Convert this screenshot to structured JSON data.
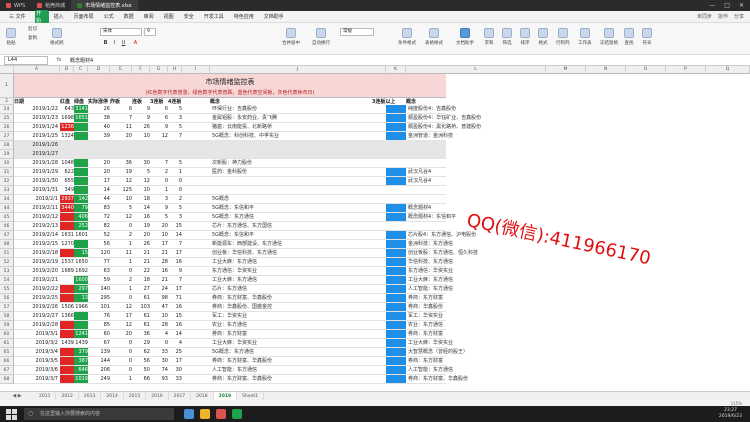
{
  "titlebar": {
    "tabs": [
      {
        "label": "WPS"
      },
      {
        "label": "稻壳商城"
      },
      {
        "label": "市场情绪监控表.xlsx"
      }
    ],
    "controls": [
      "—",
      "□",
      "✕"
    ]
  },
  "menubar": {
    "items": [
      "三 文件",
      "开始",
      "插入",
      "页面布局",
      "公式",
      "数据",
      "审阅",
      "视图",
      "安全",
      "开发工具",
      "特色应用",
      "文档助手"
    ],
    "right": [
      "未同步",
      "协作",
      "分享"
    ]
  },
  "ribbon": {
    "paste": "粘贴",
    "cut": "剪切",
    "copy": "复制",
    "format_painter": "格式刷",
    "font": "宋体",
    "size": "9",
    "merge": "合并居中",
    "wrap": "自动换行",
    "number_format": "常规",
    "conditional": "条件格式",
    "table_style": "表格样式",
    "doc_helper": "文档助手",
    "sum": "求和",
    "filter": "筛选",
    "sort": "排序",
    "format": "格式",
    "row_col": "行和列",
    "worksheet": "工作表",
    "freeze": "冻结窗格",
    "find": "查找",
    "symbol": "符号"
  },
  "formulabar": {
    "namebox": "L44",
    "fx": "fx",
    "content": "概念题材4"
  },
  "sheet": {
    "title": "市场情绪监控表",
    "subtitle": "(红色数字代表普涨，绿色数字代表普跌，蓝色代表空间板，灰色代表休市日)",
    "headers": {
      "date": "日期",
      "up": "红盘",
      "down": "绿盘",
      "limit_up": "实际涨停",
      "fail": "炸板",
      "l2": "连板",
      "l3": "3连板",
      "l4": "4连板",
      "concept": "概念",
      "above": "3连板以上",
      "concept2": "概念"
    },
    "rows": [
      {
        "r": "24",
        "date": "2019/1/22",
        "v": [
          "643",
          "3141",
          "26",
          "6",
          "9",
          "6",
          "5"
        ],
        "t1": "环保行业：吉鑫股份",
        "t2": "纯度股份4：吉鑫股份",
        "hl": "n2g"
      },
      {
        "r": "25",
        "date": "2019/1/23",
        "v": [
          "1698",
          "1651",
          "38",
          "7",
          "9",
          "6",
          "3"
        ],
        "t1": "金属铝股：永安药业、贵飞腾",
        "t2": "顺盈股份4：华钰矿业、吉鑫股份",
        "hl": "n2g"
      },
      {
        "r": "26",
        "date": "2019/1/24",
        "v": [
          "1236",
          "",
          "40",
          "11",
          "26",
          "9",
          "5"
        ],
        "t1": "猪瘟：云南能投、北新路桥",
        "t2": "顺盈股份4：黑化路桥、普建股份",
        "hl": "n1r"
      },
      {
        "r": "27",
        "date": "2019/1/25",
        "v": [
          "1324",
          "",
          "39",
          "20",
          "10",
          "12",
          "7"
        ],
        "t1": "5G概念：科创科技、中孚实业",
        "t2": "金洲管道：金洲科技",
        "hl": "n2g"
      },
      {
        "r": "28",
        "date": "2019/1/26",
        "v": [
          "",
          "",
          "",
          "",
          "",
          "",
          ""
        ],
        "t1": "",
        "t2": "",
        "hl": "gray"
      },
      {
        "r": "29",
        "date": "2019/1/27",
        "v": [
          "",
          "",
          "",
          "",
          "",
          "",
          ""
        ],
        "t1": "",
        "t2": "",
        "hl": "gray"
      },
      {
        "r": "30",
        "date": "2019/1/28",
        "v": [
          "1048",
          "",
          "20",
          "36",
          "30",
          "7",
          "5"
        ],
        "t1": "次新股：神力股份",
        "t2": "",
        "hl": "n2g"
      },
      {
        "r": "31",
        "date": "2019/1/29",
        "v": [
          "622",
          "",
          "20",
          "19",
          "5",
          "2",
          "1"
        ],
        "t1": "医药：金科股份",
        "t2": "武汉凡谷4",
        "hl": "n2g"
      },
      {
        "r": "32",
        "date": "2019/1/30",
        "v": [
          "655",
          "",
          "17",
          "12",
          "12",
          "0",
          "0"
        ],
        "t1": "",
        "t2": "武汉凡谷4",
        "hl": "n2g"
      },
      {
        "r": "33",
        "date": "2019/1/31",
        "v": [
          "349",
          "",
          "14",
          "125",
          "10",
          "1",
          "0"
        ],
        "t1": "",
        "t2": "",
        "hl": "n2g"
      },
      {
        "r": "34",
        "date": "2019/2/1",
        "v": [
          "2937",
          "142",
          "44",
          "10",
          "18",
          "3",
          "2"
        ],
        "t1": "5G概念",
        "t2": "",
        "hl": "n1r"
      },
      {
        "r": "44",
        "date": "2019/2/11",
        "v": [
          "3440",
          "79",
          "83",
          "5",
          "14",
          "9",
          "5"
        ],
        "t1": "5G概念：东信和平",
        "t2": "概念题材4",
        "hl": "n1r"
      },
      {
        "r": "45",
        "date": "2019/2/12",
        "v": [
          "",
          "406",
          "72",
          "12",
          "16",
          "5",
          "3"
        ],
        "t1": "5G概念：东方通信",
        "t2": "概念题材4：东信和平",
        "hl": "n1r"
      },
      {
        "r": "46",
        "date": "2019/2/13",
        "v": [
          "",
          "252",
          "82",
          "0",
          "19",
          "20",
          "15"
        ],
        "t1": "芯片：东方通信、东方国信",
        "t2": "",
        "hl": "n1r"
      },
      {
        "r": "47",
        "date": "2019/2/14",
        "v": [
          "1631",
          "1601",
          "52",
          "2",
          "20",
          "10",
          "14"
        ],
        "t1": "5G概念：东信和平",
        "t2": "芯片股4：东方通信、沪电股份",
        "hl": "none"
      },
      {
        "r": "48",
        "date": "2019/2/15",
        "v": [
          "1270",
          "",
          "56",
          "1",
          "26",
          "17",
          "7"
        ],
        "t1": "新能源车：西部建设、东方通信",
        "t2": "金洲科技：东方通信",
        "hl": "n2g"
      },
      {
        "r": "51",
        "date": "2019/2/18",
        "v": [
          "",
          "15",
          "120",
          "11",
          "21",
          "21",
          "17"
        ],
        "t1": "创业板：华信科技、东方通信",
        "t2": "创业板股：东方通信、恒久科技",
        "hl": "n1r"
      },
      {
        "r": "52",
        "date": "2019/2/19",
        "v": [
          "1537",
          "1650",
          "77",
          "1",
          "21",
          "28",
          "16"
        ],
        "t1": "工业大麻：东方通信",
        "t2": "华信科技、东方通信",
        "hl": "none"
      },
      {
        "r": "53",
        "date": "2019/2/20",
        "v": [
          "1689",
          "1692",
          "63",
          "0",
          "22",
          "16",
          "9"
        ],
        "t1": "东方通信：华资实业",
        "t2": "东方通信：华资实业",
        "hl": "none"
      },
      {
        "r": "54",
        "date": "2019/2/21",
        "v": [
          "",
          "1600",
          "59",
          "2",
          "18",
          "21",
          "7"
        ],
        "t1": "工业大麻：东方通信",
        "t2": "工业大麻：东方通信",
        "hl": "n2g"
      },
      {
        "r": "55",
        "date": "2019/2/22",
        "v": [
          "",
          "297",
          "140",
          "1",
          "27",
          "24",
          "17"
        ],
        "t1": "芯片：东方通信",
        "t2": "人工智能：东方通信",
        "hl": "n1r"
      },
      {
        "r": "56",
        "date": "2019/2/25",
        "v": [
          "",
          "13",
          "295",
          "0",
          "61",
          "98",
          "71"
        ],
        "t1": "券商：东方财富、华鑫股份",
        "t2": "券商：东方财富",
        "hl": "n1r"
      },
      {
        "r": "57",
        "date": "2019/2/26",
        "v": [
          "1506",
          "1966",
          "101",
          "12",
          "103",
          "47",
          "16"
        ],
        "t1": "券商：华鑫股份、国盛金控",
        "t2": "券商：华鑫股份",
        "hl": "none"
      },
      {
        "r": "58",
        "date": "2019/2/27",
        "v": [
          "1366",
          "",
          "76",
          "17",
          "61",
          "10",
          "15"
        ],
        "t1": "军工：华资实业",
        "t2": "军工：华资实业",
        "hl": "n2g"
      },
      {
        "r": "59",
        "date": "2019/2/28",
        "v": [
          "",
          "",
          "85",
          "12",
          "61",
          "28",
          "16"
        ],
        "t1": "农业：东方通信",
        "t2": "农业：东方通信",
        "hl": "n1r"
      },
      {
        "r": "60",
        "date": "2019/3/1",
        "v": [
          "",
          "1241",
          "60",
          "20",
          "36",
          "4",
          "14"
        ],
        "t1": "券商：东方财富",
        "t2": "券商：东方财富",
        "hl": "n1r"
      },
      {
        "r": "61",
        "date": "2019/3/2",
        "v": [
          "1439",
          "1439",
          "67",
          "0",
          "29",
          "0",
          "4"
        ],
        "t1": "工业大麻：华资实业",
        "t2": "工业大麻：华资实业",
        "hl": "none"
      },
      {
        "r": "65",
        "date": "2019/3/4",
        "v": [
          "",
          "379",
          "139",
          "0",
          "62",
          "33",
          "25"
        ],
        "t1": "5G概念：东方通信",
        "t2": "大智慧概念（曾经的股王）",
        "hl": "n1r"
      },
      {
        "r": "66",
        "date": "2019/3/5",
        "v": [
          "",
          "387",
          "144",
          "0",
          "56",
          "30",
          "17"
        ],
        "t1": "券商：东方财富、华鑫股份",
        "t2": "券商：东方财富",
        "hl": "n1r"
      },
      {
        "r": "67",
        "date": "2019/3/6",
        "v": [
          "",
          "646",
          "206",
          "0",
          "50",
          "74",
          "30"
        ],
        "t1": "人工智能：东方通信",
        "t2": "人工智能：东方通信",
        "hl": "n1r"
      },
      {
        "r": "68",
        "date": "2019/3/7",
        "v": [
          "",
          "1019",
          "249",
          "1",
          "66",
          "93",
          "33"
        ],
        "t1": "券商：东方财富、华鑫股份",
        "t2": "券商：东方财富、华鑫股份",
        "hl": "n1r"
      }
    ]
  },
  "watermark": "QQ(微信):411966170",
  "sheet_tabs": [
    "2011",
    "2012",
    "2013",
    "2014",
    "2015",
    "2016",
    "2017",
    "2018",
    "2019",
    "Sheet1"
  ],
  "active_sheet": "2019",
  "statusbar": {
    "zoom": "115%"
  },
  "taskbar": {
    "search_placeholder": "在这里输入你要搜索的内容",
    "time": "23:27",
    "date": "2019/6/23"
  },
  "colors": {
    "red": "#e02525",
    "green": "#1fa34a",
    "blue": "#1e90e8",
    "title_bg": "#f7d6d6",
    "wps_green": "#1f9d55"
  }
}
